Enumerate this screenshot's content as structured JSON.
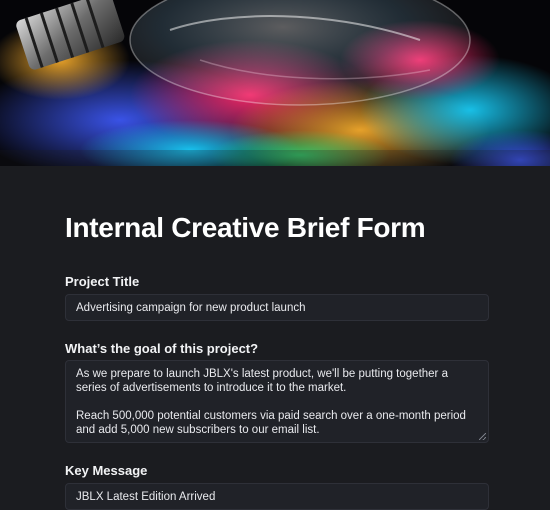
{
  "hero": {
    "image": "light-bulb-on-iridescent-surface"
  },
  "form": {
    "title": "Internal Creative Brief Form",
    "fields": [
      {
        "label": "Project Title",
        "value": "Advertising campaign for new product launch"
      },
      {
        "label": "What’s the goal of this project?",
        "paragraphs": [
          "As we prepare to launch JBLX's latest product, we'll be putting together a series of advertisements to introduce it to the market.",
          "Reach 500,000 potential customers via paid search over a one-month period and add 5,000 new subscribers to our email list."
        ]
      },
      {
        "label": "Key Message",
        "value": "JBLX Latest Edition Arrived"
      }
    ]
  },
  "colors": {
    "background": "#1b1c20",
    "field_background": "#202228",
    "field_border": "#2e3038",
    "text": "#ffffff"
  }
}
